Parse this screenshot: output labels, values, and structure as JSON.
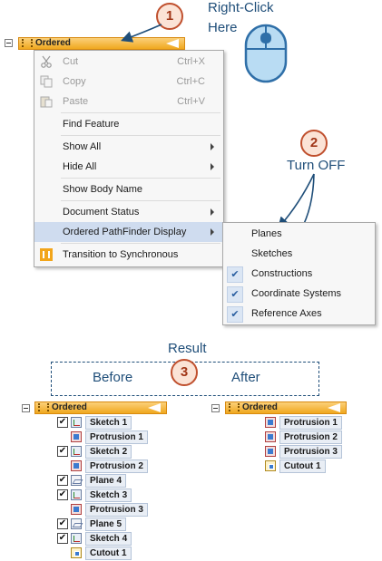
{
  "callouts": {
    "step1": "1",
    "right_click_line1": "Right-Click",
    "right_click_line2": "Here",
    "step2": "2",
    "turn_off": "Turn OFF",
    "result": "Result",
    "step3": "3",
    "before": "Before",
    "after": "After"
  },
  "top_tree": {
    "label": "Ordered"
  },
  "context_menu": {
    "items": [
      {
        "label": "Cut",
        "shortcut": "Ctrl+X"
      },
      {
        "label": "Copy",
        "shortcut": "Ctrl+C"
      },
      {
        "label": "Paste",
        "shortcut": "Ctrl+V"
      },
      {
        "label": "Find Feature"
      },
      {
        "label": "Show All"
      },
      {
        "label": "Hide All"
      },
      {
        "label": "Show Body Name"
      },
      {
        "label": "Document Status"
      },
      {
        "label": "Ordered PathFinder Display"
      },
      {
        "label": "Transition to Synchronous"
      }
    ]
  },
  "submenu": {
    "items": [
      {
        "label": "Planes",
        "checked": false
      },
      {
        "label": "Sketches",
        "checked": false
      },
      {
        "label": "Constructions",
        "checked": true
      },
      {
        "label": "Coordinate Systems",
        "checked": true
      },
      {
        "label": "Reference Axes",
        "checked": true
      }
    ],
    "check_glyph": "✔"
  },
  "before_tree": {
    "header": "Ordered",
    "items": [
      {
        "label": "Sketch 1",
        "type": "sketch",
        "checkbox": true
      },
      {
        "label": "Protrusion 1",
        "type": "protrusion",
        "checkbox": false
      },
      {
        "label": "Sketch 2",
        "type": "sketch",
        "checkbox": true
      },
      {
        "label": "Protrusion 2",
        "type": "protrusion",
        "checkbox": false
      },
      {
        "label": "Plane 4",
        "type": "plane",
        "checkbox": true
      },
      {
        "label": "Sketch 3",
        "type": "sketch",
        "checkbox": true
      },
      {
        "label": "Protrusion 3",
        "type": "protrusion",
        "checkbox": false
      },
      {
        "label": "Plane 5",
        "type": "plane",
        "checkbox": true
      },
      {
        "label": "Sketch 4",
        "type": "sketch",
        "checkbox": true
      },
      {
        "label": "Cutout 1",
        "type": "cutout",
        "checkbox": false
      }
    ]
  },
  "after_tree": {
    "header": "Ordered",
    "items": [
      {
        "label": "Protrusion 1",
        "type": "protrusion"
      },
      {
        "label": "Protrusion 2",
        "type": "protrusion"
      },
      {
        "label": "Protrusion 3",
        "type": "protrusion"
      },
      {
        "label": "Cutout 1",
        "type": "cutout"
      }
    ]
  },
  "colors": {
    "accent": "#1f4e79",
    "badge_border": "#c0502e",
    "ordered_bar": "#f0a81e",
    "menu_highlight": "#cfdcef"
  }
}
